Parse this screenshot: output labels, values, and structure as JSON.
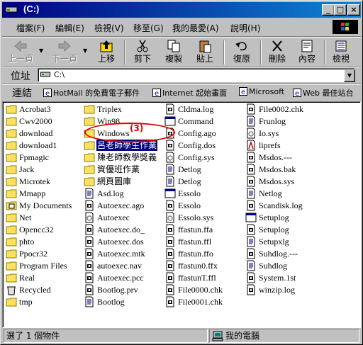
{
  "window": {
    "title": "(C:)"
  },
  "titlebar": {
    "minimize": "_",
    "maximize": "□",
    "close": "×"
  },
  "menu": [
    "檔案(F)",
    "編輯(E)",
    "檢視(V)",
    "移至(G)",
    "我的最愛(A)",
    "說明(H)"
  ],
  "toolbar": {
    "back": "上一頁",
    "forward": "下一頁",
    "up": "上移",
    "cut": "剪下",
    "copy": "複製",
    "paste": "貼上",
    "undo": "復原",
    "delete": "刪除",
    "properties": "內容",
    "views": "檢視"
  },
  "address": {
    "label": "位址",
    "value": "C:\\"
  },
  "links": {
    "label": "連結",
    "items": [
      "HotMail 的免費電子郵件",
      "Internet 起始畫面",
      "Microsoft",
      "Web 最佳站台"
    ]
  },
  "files": {
    "col1": [
      {
        "name": "Acrobat3",
        "icon": "folder"
      },
      {
        "name": "Cwv2000",
        "icon": "folder"
      },
      {
        "name": "download",
        "icon": "folder"
      },
      {
        "name": "download1",
        "icon": "folder"
      },
      {
        "name": "Fpmagic",
        "icon": "folder"
      },
      {
        "name": "Jack",
        "icon": "folder"
      },
      {
        "name": "Microtek",
        "icon": "folder"
      },
      {
        "name": "Mmapp",
        "icon": "folder"
      },
      {
        "name": "My Documents",
        "icon": "mydocs"
      },
      {
        "name": "Net",
        "icon": "folder"
      },
      {
        "name": "Opencc32",
        "icon": "folder"
      },
      {
        "name": "phto",
        "icon": "folder"
      },
      {
        "name": "Ppocr32",
        "icon": "folder"
      },
      {
        "name": "Program Files",
        "icon": "folder"
      },
      {
        "name": "Real",
        "icon": "folder"
      },
      {
        "name": "Recycled",
        "icon": "recycle"
      },
      {
        "name": "tmp",
        "icon": "folder"
      }
    ],
    "col2": [
      {
        "name": "Triplex",
        "icon": "folder"
      },
      {
        "name": "Win98",
        "icon": "folder"
      },
      {
        "name": "Windows",
        "icon": "folder"
      },
      {
        "name": "呂老師學生作業",
        "icon": "folder",
        "selected": true
      },
      {
        "name": "陳老師教學獎義",
        "icon": "folder"
      },
      {
        "name": "資優班作業",
        "icon": "folder"
      },
      {
        "name": "網頁圖庫",
        "icon": "folder"
      },
      {
        "name": "Asd.log",
        "icon": "text"
      },
      {
        "name": "Autoexec.ago",
        "icon": "file"
      },
      {
        "name": "Autoexec",
        "icon": "sys"
      },
      {
        "name": "Autoexec.do_",
        "icon": "file"
      },
      {
        "name": "Autoexec.dos",
        "icon": "file"
      },
      {
        "name": "Autoexec.mtk",
        "icon": "file"
      },
      {
        "name": "autoexec.nav",
        "icon": "file"
      },
      {
        "name": "Autoexec.pcc",
        "icon": "file"
      },
      {
        "name": "Bootlog.prv",
        "icon": "file"
      },
      {
        "name": "Bootlog",
        "icon": "text"
      }
    ],
    "col3": [
      {
        "name": "Cldma.log",
        "icon": "file"
      },
      {
        "name": "Command",
        "icon": "app"
      },
      {
        "name": "Config.ago",
        "icon": "file"
      },
      {
        "name": "Config.dos",
        "icon": "file"
      },
      {
        "name": "Config.sys",
        "icon": "sys"
      },
      {
        "name": "Detlog",
        "icon": "text"
      },
      {
        "name": "Detlog",
        "icon": "text"
      },
      {
        "name": "Essolo",
        "icon": "app"
      },
      {
        "name": "Essolo",
        "icon": "file"
      },
      {
        "name": "Essolo.sys",
        "icon": "sys"
      },
      {
        "name": "ffastun.ffa",
        "icon": "file"
      },
      {
        "name": "ffastun.ffl",
        "icon": "file"
      },
      {
        "name": "ffastun.ffo",
        "icon": "file"
      },
      {
        "name": "ffastun0.ffx",
        "icon": "file"
      },
      {
        "name": "ffastunT.ffl",
        "icon": "file"
      },
      {
        "name": "File0000.chk",
        "icon": "file"
      },
      {
        "name": "File0001.chk",
        "icon": "file"
      }
    ],
    "col4": [
      {
        "name": "File0002.chk",
        "icon": "file"
      },
      {
        "name": "Frunlog",
        "icon": "text"
      },
      {
        "name": "Io.sys",
        "icon": "sys"
      },
      {
        "name": "liprefs",
        "icon": "special"
      },
      {
        "name": "Msdos.---",
        "icon": "file"
      },
      {
        "name": "Msdos.bak",
        "icon": "file"
      },
      {
        "name": "Msdos.sys",
        "icon": "file"
      },
      {
        "name": "Netlog",
        "icon": "text"
      },
      {
        "name": "Scandisk.log",
        "icon": "file"
      },
      {
        "name": "Setuplog",
        "icon": "app"
      },
      {
        "name": "Setuplog",
        "icon": "file"
      },
      {
        "name": "Setupxlg",
        "icon": "text"
      },
      {
        "name": "Suhdlog.---",
        "icon": "file"
      },
      {
        "name": "Suhdlog",
        "icon": "text"
      },
      {
        "name": "System.1st",
        "icon": "file"
      },
      {
        "name": "winzip.log",
        "icon": "file"
      }
    ]
  },
  "annotation": {
    "number": "(3)"
  },
  "status": {
    "left": "選了 1 個物件",
    "right": "我的電腦"
  }
}
